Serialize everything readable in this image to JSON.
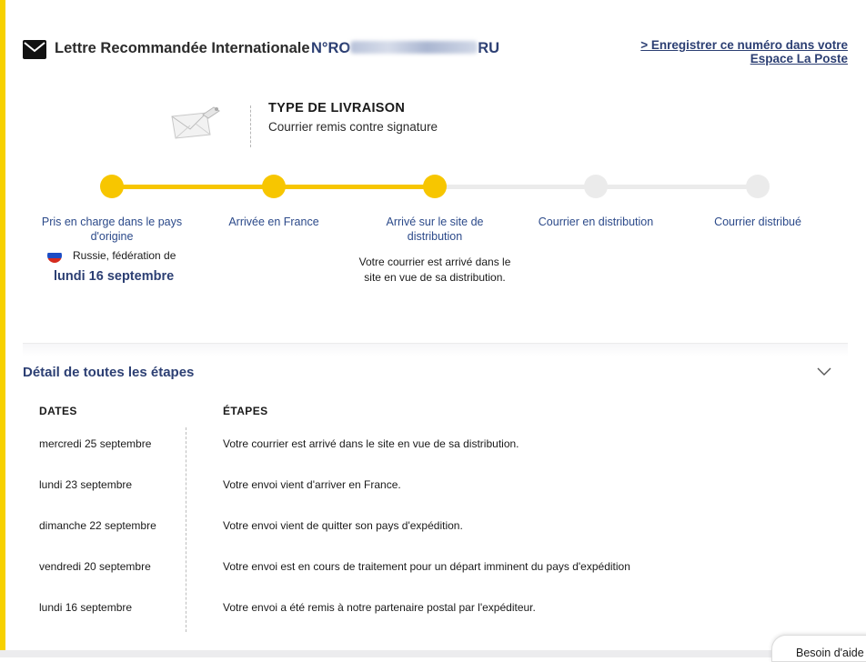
{
  "header": {
    "title": "Lettre Recommandée Internationale",
    "tracking_prefix": "N°RO",
    "tracking_suffix": "RU",
    "register_link_line1": "> Enregistrer ce numéro dans votre",
    "register_link_line2": "Espace La Poste"
  },
  "delivery_type": {
    "title": "TYPE DE LIVRAISON",
    "value": "Courrier remis contre signature"
  },
  "progress": {
    "completed_steps": 3,
    "steps": [
      {
        "label": "Pris en charge dans le pays d'origine"
      },
      {
        "label": "Arrivée en France"
      },
      {
        "label": "Arrivé sur le site de distribution"
      },
      {
        "label": "Courrier en distribution"
      },
      {
        "label": "Courrier distribué"
      }
    ],
    "origin_country": "Russie, fédération de",
    "start_date": "lundi 16 septembre",
    "current_step_description": "Votre courrier est arrivé dans le site en vue de sa distribution."
  },
  "details": {
    "title": "Détail de toutes les étapes",
    "col_dates": "DATES",
    "col_steps": "ÉTAPES",
    "rows": [
      {
        "date": "mercredi 25 septembre",
        "step": "Votre courrier est arrivé dans le site en vue de sa distribution."
      },
      {
        "date": "lundi 23 septembre",
        "step": "Votre envoi vient d'arriver en France."
      },
      {
        "date": "dimanche 22 septembre",
        "step": "Votre envoi vient de quitter son pays d'expédition."
      },
      {
        "date": "vendredi 20 septembre",
        "step": "Votre envoi est en cours de traitement pour un départ imminent du pays d'expédition"
      },
      {
        "date": "lundi 16 septembre",
        "step": "Votre envoi a été remis à notre partenaire postal par l'expéditeur."
      }
    ]
  },
  "help": {
    "label": "Besoin d'aide"
  },
  "colors": {
    "accent_yellow": "#f7c600",
    "brand_blue": "#2c3f73",
    "track_grey": "#ebebeb"
  },
  "icons": {
    "header": "envelope-icon",
    "delivery": "envelope-illustration",
    "origin": "russia-flag-icon",
    "details_toggle": "chevron-down-icon"
  }
}
